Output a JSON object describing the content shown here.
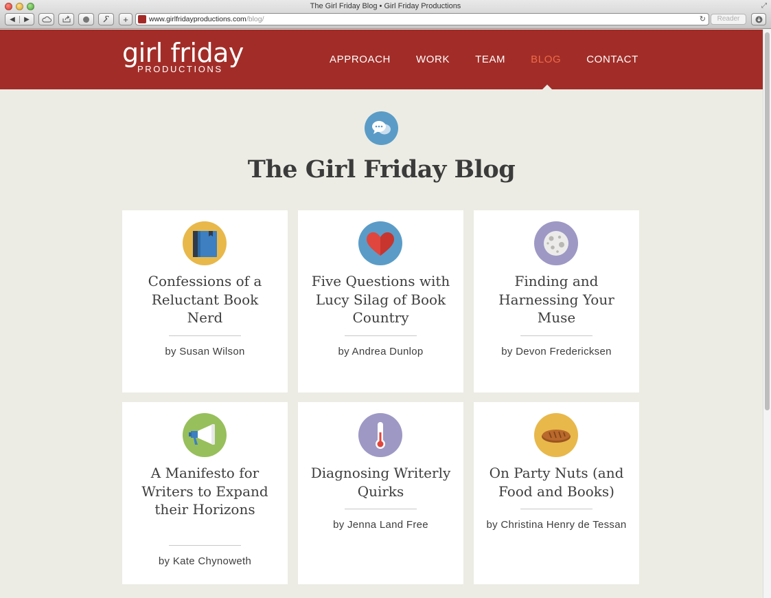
{
  "browser": {
    "window_title": "The Girl Friday Blog • Girl Friday Productions",
    "url_host": "www.girlfridayproductions.com",
    "url_path": "/blog/",
    "reader_label": "Reader"
  },
  "site": {
    "logo_main": "girl friday",
    "logo_sub": "PRODUCTIONS",
    "brand_color": "#a22d28",
    "accent_color": "#ef6a48",
    "nav": [
      {
        "label": "APPROACH"
      },
      {
        "label": "WORK"
      },
      {
        "label": "TEAM"
      },
      {
        "label": "BLOG",
        "active": true
      },
      {
        "label": "CONTACT"
      }
    ]
  },
  "blog": {
    "icon": "speech-bubbles-icon",
    "title": "The Girl Friday Blog",
    "posts": [
      {
        "title": "Confessions of a Reluctant Book Nerd",
        "author": "by Susan Wilson",
        "icon": "book-icon",
        "icon_bg": "#e8b84a"
      },
      {
        "title": "Five Questions with Lucy Silag of Book Country",
        "author": "by Andrea Dunlop",
        "icon": "heart-icon",
        "icon_bg": "#5a9cc7"
      },
      {
        "title": "Finding and Harnessing Your Muse",
        "author": "by Devon Fredericksen",
        "icon": "moon-icon",
        "icon_bg": "#9d98c4"
      },
      {
        "title": "A Manifesto for Writers to Expand their Horizons",
        "author": "by Kate Chynoweth",
        "icon": "megaphone-icon",
        "icon_bg": "#97bf5b"
      },
      {
        "title": "Diagnosing Writerly Quirks",
        "author": "by Jenna Land Free",
        "icon": "thermometer-icon",
        "icon_bg": "#9d98c4"
      },
      {
        "title": "On Party Nuts (and Food and Books)",
        "author": "by Christina Henry de Tessan",
        "icon": "bread-icon",
        "icon_bg": "#e8b84a"
      }
    ]
  }
}
